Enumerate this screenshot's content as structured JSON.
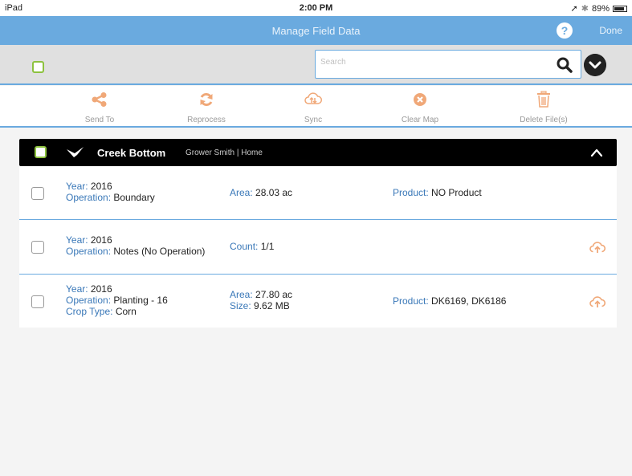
{
  "status_bar": {
    "device": "iPad",
    "time": "2:00 PM",
    "battery": "89%",
    "battery_level": 0.89
  },
  "nav": {
    "title": "Manage Field Data",
    "help": "?",
    "done": "Done"
  },
  "search": {
    "placeholder": "Search",
    "value": ""
  },
  "actions": [
    {
      "label": "Send To",
      "icon": "share-icon"
    },
    {
      "label": "Reprocess",
      "icon": "refresh-icon"
    },
    {
      "label": "Sync",
      "icon": "cloud-sync-icon"
    },
    {
      "label": "Clear Map",
      "icon": "clear-circle-icon"
    },
    {
      "label": "Delete File(s)",
      "icon": "trash-icon"
    }
  ],
  "group": {
    "title": "Creek Bottom",
    "subtitle": "Grower Smith | Home"
  },
  "rows": [
    {
      "year_label": "Year:",
      "year": " 2016",
      "operation_label": "Operation:",
      "operation": " Boundary",
      "m1_label": "Area:",
      "m1": " 28.03 ac",
      "product_label": "Product:",
      "product": " NO Product"
    },
    {
      "year_label": "Year:",
      "year": " 2016",
      "operation_label": "Operation:",
      "operation": " Notes (No Operation)",
      "m1_label": "Count:",
      "m1": " 1/1"
    },
    {
      "year_label": "Year:",
      "year": " 2016",
      "operation_label": "Operation:",
      "operation": " Planting - 16",
      "crop_label": "Crop Type:",
      "crop": " Corn",
      "m1_label": "Area:",
      "m1": " 27.80 ac",
      "m2_label": "Size:",
      "m2": " 9.62 MB",
      "product_label": "Product:",
      "product": " DK6169, DK6186"
    }
  ],
  "colors": {
    "accent": "#6aaadf",
    "action_orange": "#f0a878",
    "checkbox_green": "#8dc23f",
    "label_blue": "#3a78b8"
  }
}
